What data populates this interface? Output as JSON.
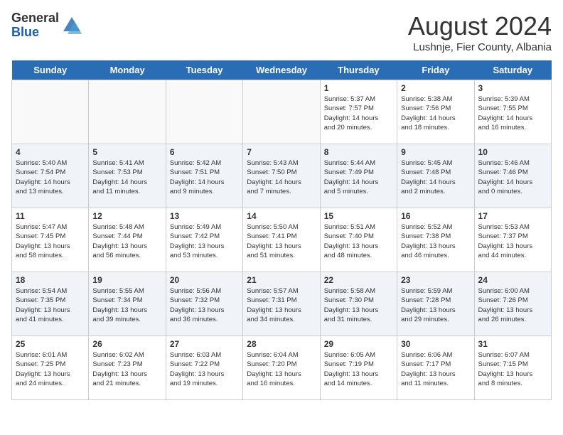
{
  "header": {
    "logo_general": "General",
    "logo_blue": "Blue",
    "month": "August 2024",
    "location": "Lushnje, Fier County, Albania"
  },
  "weekdays": [
    "Sunday",
    "Monday",
    "Tuesday",
    "Wednesday",
    "Thursday",
    "Friday",
    "Saturday"
  ],
  "weeks": [
    [
      {
        "day": "",
        "info": ""
      },
      {
        "day": "",
        "info": ""
      },
      {
        "day": "",
        "info": ""
      },
      {
        "day": "",
        "info": ""
      },
      {
        "day": "1",
        "info": "Sunrise: 5:37 AM\nSunset: 7:57 PM\nDaylight: 14 hours\nand 20 minutes."
      },
      {
        "day": "2",
        "info": "Sunrise: 5:38 AM\nSunset: 7:56 PM\nDaylight: 14 hours\nand 18 minutes."
      },
      {
        "day": "3",
        "info": "Sunrise: 5:39 AM\nSunset: 7:55 PM\nDaylight: 14 hours\nand 16 minutes."
      }
    ],
    [
      {
        "day": "4",
        "info": "Sunrise: 5:40 AM\nSunset: 7:54 PM\nDaylight: 14 hours\nand 13 minutes."
      },
      {
        "day": "5",
        "info": "Sunrise: 5:41 AM\nSunset: 7:53 PM\nDaylight: 14 hours\nand 11 minutes."
      },
      {
        "day": "6",
        "info": "Sunrise: 5:42 AM\nSunset: 7:51 PM\nDaylight: 14 hours\nand 9 minutes."
      },
      {
        "day": "7",
        "info": "Sunrise: 5:43 AM\nSunset: 7:50 PM\nDaylight: 14 hours\nand 7 minutes."
      },
      {
        "day": "8",
        "info": "Sunrise: 5:44 AM\nSunset: 7:49 PM\nDaylight: 14 hours\nand 5 minutes."
      },
      {
        "day": "9",
        "info": "Sunrise: 5:45 AM\nSunset: 7:48 PM\nDaylight: 14 hours\nand 2 minutes."
      },
      {
        "day": "10",
        "info": "Sunrise: 5:46 AM\nSunset: 7:46 PM\nDaylight: 14 hours\nand 0 minutes."
      }
    ],
    [
      {
        "day": "11",
        "info": "Sunrise: 5:47 AM\nSunset: 7:45 PM\nDaylight: 13 hours\nand 58 minutes."
      },
      {
        "day": "12",
        "info": "Sunrise: 5:48 AM\nSunset: 7:44 PM\nDaylight: 13 hours\nand 56 minutes."
      },
      {
        "day": "13",
        "info": "Sunrise: 5:49 AM\nSunset: 7:42 PM\nDaylight: 13 hours\nand 53 minutes."
      },
      {
        "day": "14",
        "info": "Sunrise: 5:50 AM\nSunset: 7:41 PM\nDaylight: 13 hours\nand 51 minutes."
      },
      {
        "day": "15",
        "info": "Sunrise: 5:51 AM\nSunset: 7:40 PM\nDaylight: 13 hours\nand 48 minutes."
      },
      {
        "day": "16",
        "info": "Sunrise: 5:52 AM\nSunset: 7:38 PM\nDaylight: 13 hours\nand 46 minutes."
      },
      {
        "day": "17",
        "info": "Sunrise: 5:53 AM\nSunset: 7:37 PM\nDaylight: 13 hours\nand 44 minutes."
      }
    ],
    [
      {
        "day": "18",
        "info": "Sunrise: 5:54 AM\nSunset: 7:35 PM\nDaylight: 13 hours\nand 41 minutes."
      },
      {
        "day": "19",
        "info": "Sunrise: 5:55 AM\nSunset: 7:34 PM\nDaylight: 13 hours\nand 39 minutes."
      },
      {
        "day": "20",
        "info": "Sunrise: 5:56 AM\nSunset: 7:32 PM\nDaylight: 13 hours\nand 36 minutes."
      },
      {
        "day": "21",
        "info": "Sunrise: 5:57 AM\nSunset: 7:31 PM\nDaylight: 13 hours\nand 34 minutes."
      },
      {
        "day": "22",
        "info": "Sunrise: 5:58 AM\nSunset: 7:30 PM\nDaylight: 13 hours\nand 31 minutes."
      },
      {
        "day": "23",
        "info": "Sunrise: 5:59 AM\nSunset: 7:28 PM\nDaylight: 13 hours\nand 29 minutes."
      },
      {
        "day": "24",
        "info": "Sunrise: 6:00 AM\nSunset: 7:26 PM\nDaylight: 13 hours\nand 26 minutes."
      }
    ],
    [
      {
        "day": "25",
        "info": "Sunrise: 6:01 AM\nSunset: 7:25 PM\nDaylight: 13 hours\nand 24 minutes."
      },
      {
        "day": "26",
        "info": "Sunrise: 6:02 AM\nSunset: 7:23 PM\nDaylight: 13 hours\nand 21 minutes."
      },
      {
        "day": "27",
        "info": "Sunrise: 6:03 AM\nSunset: 7:22 PM\nDaylight: 13 hours\nand 19 minutes."
      },
      {
        "day": "28",
        "info": "Sunrise: 6:04 AM\nSunset: 7:20 PM\nDaylight: 13 hours\nand 16 minutes."
      },
      {
        "day": "29",
        "info": "Sunrise: 6:05 AM\nSunset: 7:19 PM\nDaylight: 13 hours\nand 14 minutes."
      },
      {
        "day": "30",
        "info": "Sunrise: 6:06 AM\nSunset: 7:17 PM\nDaylight: 13 hours\nand 11 minutes."
      },
      {
        "day": "31",
        "info": "Sunrise: 6:07 AM\nSunset: 7:15 PM\nDaylight: 13 hours\nand 8 minutes."
      }
    ]
  ]
}
